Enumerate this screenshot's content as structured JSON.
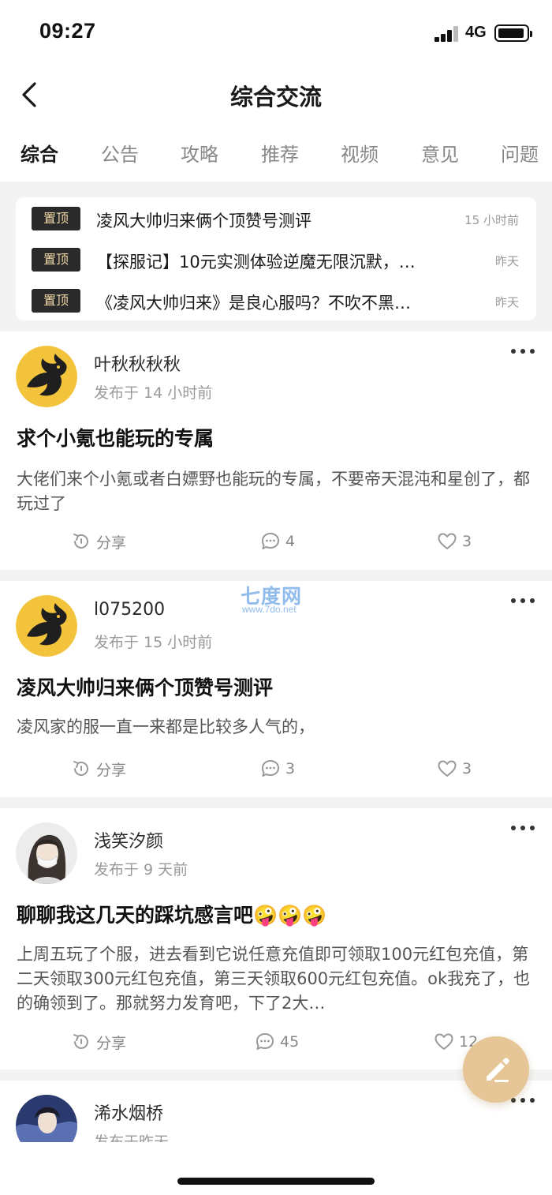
{
  "status": {
    "time": "09:27",
    "network": "4G"
  },
  "nav": {
    "title": "综合交流"
  },
  "tabs": [
    {
      "label": "综合",
      "active": true
    },
    {
      "label": "公告"
    },
    {
      "label": "攻略"
    },
    {
      "label": "推荐"
    },
    {
      "label": "视频"
    },
    {
      "label": "意见"
    },
    {
      "label": "问题"
    }
  ],
  "pinned": [
    {
      "badge": "置顶",
      "title": "凌风大帅归来俩个顶赞号测评",
      "time": "15 小时前"
    },
    {
      "badge": "置顶",
      "title": "【探服记】10元实测体验逆魔无限沉默，…",
      "time": "昨天"
    },
    {
      "badge": "置顶",
      "title": "《凌风大帅归来》是良心服吗？不吹不黑…",
      "time": "昨天"
    }
  ],
  "posts": [
    {
      "user": "叶秋秋秋秋",
      "time": "发布于 14 小时前",
      "title": "求个小氪也能玩的专属",
      "body": "大佬们来个小氪或者白嫖野也能玩的专属，不要帝天混沌和星创了，都玩过了",
      "share": "分享",
      "comments": "4",
      "likes": "3",
      "avatar": "dragon-logo"
    },
    {
      "user": "l075200",
      "time": "发布于 15 小时前",
      "title": "凌风大帅归来俩个顶赞号测评",
      "body": "凌风家的服一直一来都是比较多人气的，",
      "share": "分享",
      "comments": "3",
      "likes": "3",
      "avatar": "dragon-logo"
    },
    {
      "user": "浅笑汐颜",
      "time": "发布于 9 天前",
      "title": "聊聊我这几天的踩坑感言吧🤪🤪🤪",
      "body": "上周五玩了个服，进去看到它说任意充值即可领取100元红包充值，第二天领取300元红包充值，第三天领取600元红包充值。ok我充了，也的确领到了。那就努力发育吧，下了2大…",
      "share": "分享",
      "comments": "45",
      "likes": "12",
      "avatar": "girl-portrait"
    },
    {
      "user": "浠水烟桥",
      "time": "发布于昨天",
      "avatar": "warrior-portrait"
    }
  ],
  "watermark": {
    "main": "七度网",
    "sub": "www.7do.net"
  },
  "colors": {
    "accent": "#e6c596",
    "badge_bg": "#2a2a2a",
    "badge_text": "#f0d9a8",
    "divider": "#f3f3f3"
  }
}
